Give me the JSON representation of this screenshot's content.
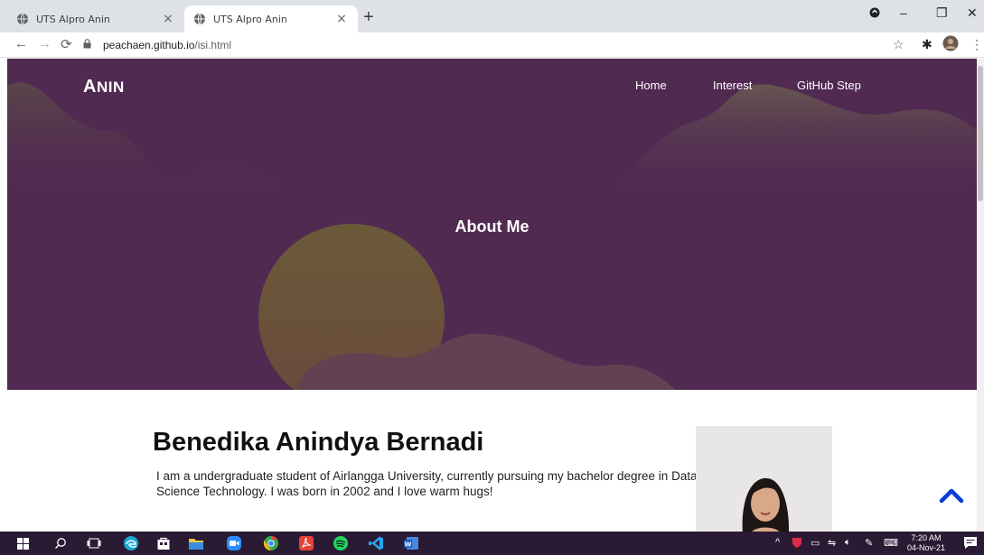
{
  "browser": {
    "tabs": [
      {
        "title": "UTS Alpro Anin",
        "active": false
      },
      {
        "title": "UTS Alpro Anin",
        "active": true
      }
    ],
    "new_tab_label": "+",
    "url_host": "peachaen.github.io",
    "url_path": "/isi.html"
  },
  "page": {
    "brand_first": "A",
    "brand_rest": "NIN",
    "nav": [
      {
        "label": "Home"
      },
      {
        "label": "Interest"
      },
      {
        "label": "GitHub Step"
      }
    ],
    "hero_title": "About Me",
    "name": "Benedika Anindya Bernadi",
    "bio": "I am a undergraduate student of Airlangga University, currently pursuing my bachelor degree in Data Science Technology. I was born in 2002 and I love warm hugs!"
  },
  "taskbar": {
    "time": "7:20 AM",
    "date": "04-Nov-21"
  },
  "colors": {
    "hero_bg": "#512a52",
    "accent_blue": "#0a3dd6"
  }
}
